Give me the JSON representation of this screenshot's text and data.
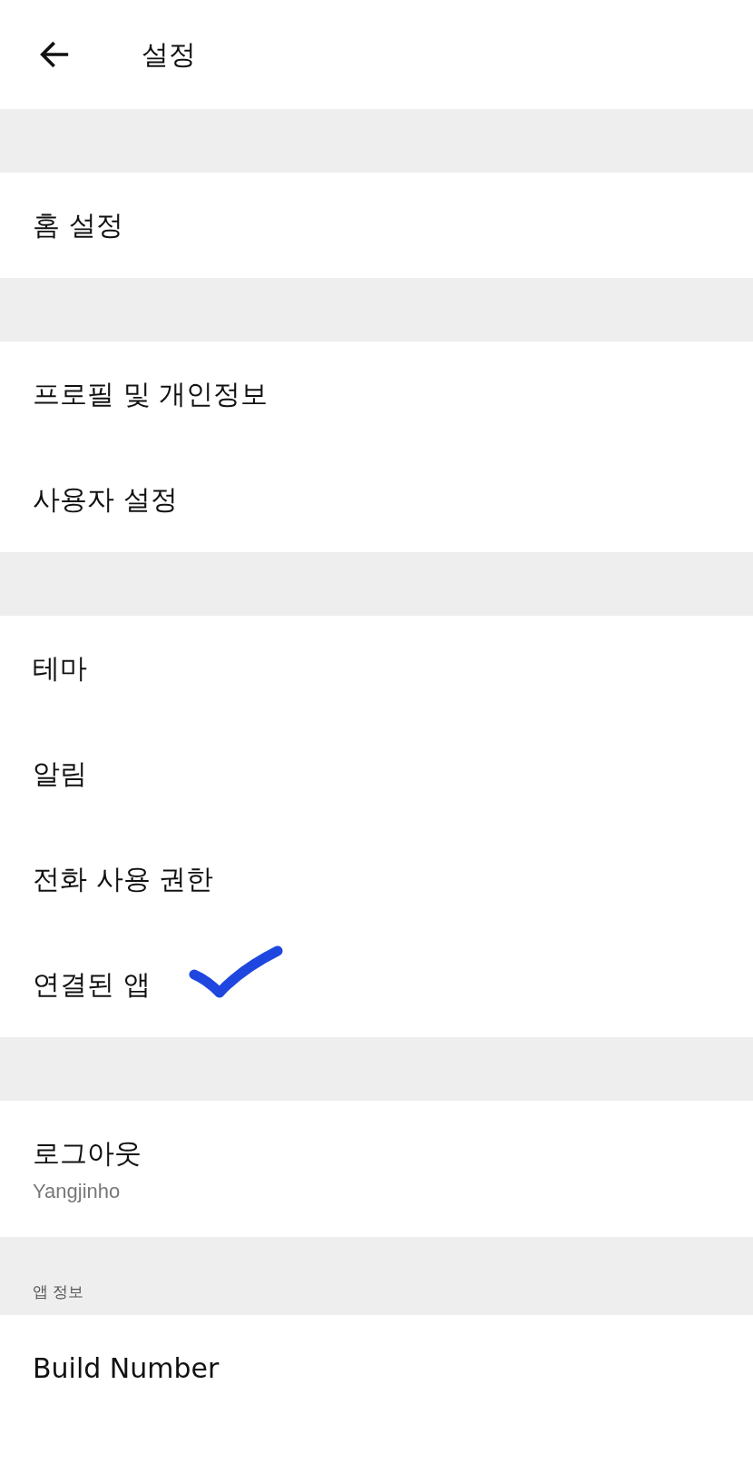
{
  "header": {
    "title": "설정"
  },
  "sections": [
    {
      "items": [
        {
          "label": "홈 설정",
          "marked": false
        }
      ]
    },
    {
      "items": [
        {
          "label": "프로필 및 개인정보",
          "marked": false
        },
        {
          "label": "사용자 설정",
          "marked": false
        }
      ]
    },
    {
      "items": [
        {
          "label": "테마",
          "marked": false
        },
        {
          "label": "알림",
          "marked": false
        },
        {
          "label": "전화 사용 권한",
          "marked": false
        },
        {
          "label": "연결된 앱",
          "marked": true
        }
      ]
    },
    {
      "items": [
        {
          "label": "로그아웃",
          "subtitle": "Yangjinho",
          "marked": false
        }
      ]
    },
    {
      "header": "앱 정보",
      "items": [
        {
          "label": "Build Number",
          "marked": false
        }
      ]
    }
  ]
}
